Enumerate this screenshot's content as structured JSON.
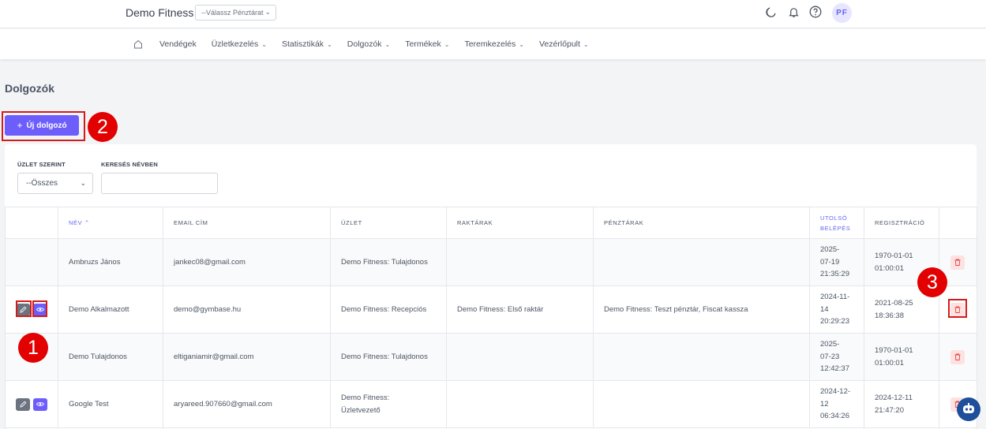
{
  "header": {
    "brand": "Demo Fitness",
    "register_select": "--Válassz Pénztárat",
    "user_initials": "PF"
  },
  "nav": {
    "items": [
      {
        "label": "Vendégek",
        "caret": false
      },
      {
        "label": "Üzletkezelés",
        "caret": true
      },
      {
        "label": "Statisztikák",
        "caret": true
      },
      {
        "label": "Dolgozók",
        "caret": true
      },
      {
        "label": "Termékek",
        "caret": true
      },
      {
        "label": "Teremkezelés",
        "caret": true
      },
      {
        "label": "Vezérlőpult",
        "caret": true
      }
    ]
  },
  "page": {
    "title": "Dolgozók",
    "new_button": "Új dolgozó"
  },
  "filters": {
    "store_label": "ÜZLET SZERINT",
    "store_value": "--Összes",
    "search_label": "KERESÉS NÉVBEN",
    "search_value": ""
  },
  "table": {
    "columns": [
      "",
      "NÉV",
      "EMAIL CÍM",
      "ÜZLET",
      "RAKTÁRAK",
      "PÉNZTÁRAK",
      "UTOLSÓ BELÉPÉS",
      "REGISZTRÁCIÓ",
      ""
    ],
    "rows": [
      {
        "name": "Ambruzs János",
        "email": "jankec08@gmail.com",
        "store": "Demo Fitness: Tulajdonos",
        "warehouses": "",
        "registers": "",
        "last_login": [
          "2025-",
          "07-19",
          "21:35:29"
        ],
        "registered": [
          "1970-01-01",
          "01:00:01"
        ],
        "actions": false
      },
      {
        "name": "Demo Alkalmazott",
        "email": "demo@gymbase.hu",
        "store": "Demo Fitness: Recepciós",
        "warehouses": "Demo Fitness: Első raktár",
        "registers": "Demo Fitness: Teszt pénztár, Fiscat kassza",
        "last_login": [
          "2024-11-",
          "14",
          "20:29:23"
        ],
        "registered": [
          "2021-08-25",
          "18:36:38"
        ],
        "actions": true
      },
      {
        "name": "Demo Tulajdonos",
        "email": "eltiganiamir@gmail.com",
        "store": "Demo Fitness: Tulajdonos",
        "warehouses": "",
        "registers": "",
        "last_login": [
          "2025-",
          "07-23",
          "12:42:37"
        ],
        "registered": [
          "1970-01-01",
          "01:00:01"
        ],
        "actions": false
      },
      {
        "name": "Google Test",
        "email": "aryareed.907660@gmail.com",
        "store": "Demo Fitness: Üzletvezető",
        "warehouses": "",
        "registers": "",
        "last_login": [
          "2024-12-",
          "12",
          "06:34:26"
        ],
        "registered": [
          "2024-12-11",
          "21:47:20"
        ],
        "actions": true
      }
    ]
  },
  "annotations": [
    "1",
    "2",
    "3"
  ],
  "colors": {
    "accent": "#6d5efc",
    "highlight": "#d31b1b",
    "badge": "#e20000",
    "delete_bg": "#fde2e2",
    "delete_icon": "#ef4444"
  }
}
